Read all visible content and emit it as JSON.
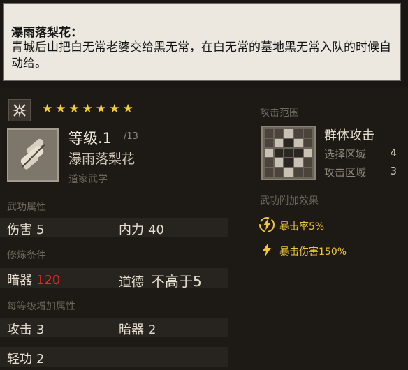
{
  "tooltip": {
    "title": "瀑雨落梨花：",
    "body": "青城后山把白无常老婆交给黑无常，在白无常的墓地黑无常入队的时候自动给。"
  },
  "skill": {
    "type_icon": "shuriken-icon",
    "stars": 7,
    "icon": "scroll-icon",
    "level": "等级.1",
    "level_max": "/13",
    "name": "瀑雨落梨花",
    "school": "道家武学"
  },
  "attributes": {
    "label": "武功属性",
    "damage_label": "伤害",
    "damage_value": "5",
    "neili_label": "内力",
    "neili_value": "40"
  },
  "requirements": {
    "label": "修炼条件",
    "anqi_label": "暗器",
    "anqi_value": "120",
    "anqi_color": "#e32a2a",
    "morality_label": "道德",
    "morality_value": "不高于5"
  },
  "per_level": {
    "label": "每等级增加属性",
    "attack_label": "攻击",
    "attack_value": "3",
    "anqi_label": "暗器",
    "anqi_value": "2",
    "qinggong_label": "轻功",
    "qinggong_value": "2"
  },
  "range": {
    "label": "攻击范围",
    "type": "群体攻击",
    "select_label": "选择区域",
    "select_value": "4",
    "attack_area_label": "攻击区域",
    "attack_area_value": "3"
  },
  "effects": {
    "label": "武功附加效果",
    "items": [
      {
        "icon": "lightning-circle-icon",
        "text": "暴击率5%"
      },
      {
        "icon": "lightning-icon",
        "text": "暴击伤害150%"
      }
    ]
  },
  "colors": {
    "star": "#f3cf38",
    "effect_text": "#f0c53a"
  }
}
